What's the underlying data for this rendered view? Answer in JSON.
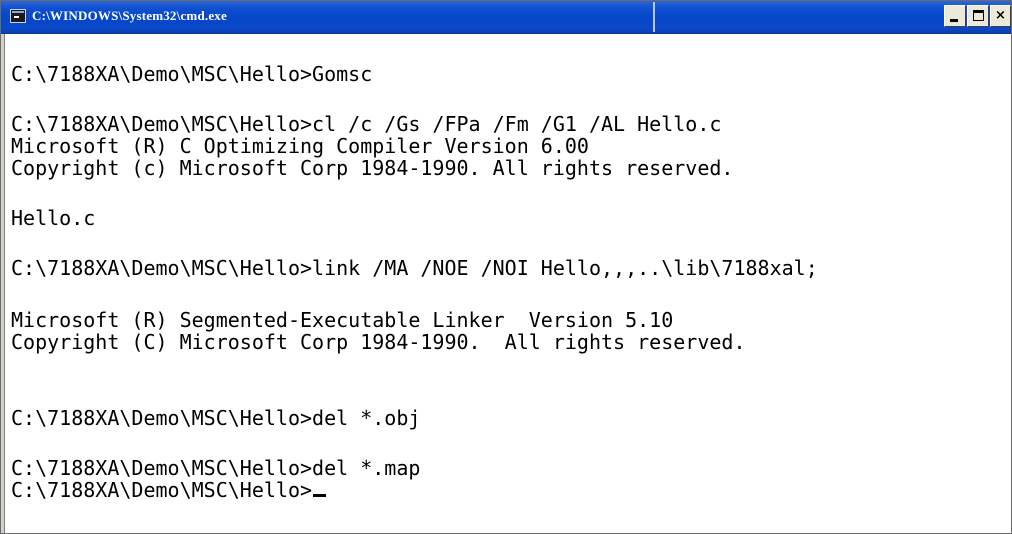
{
  "window": {
    "title": "C:\\WINDOWS\\System32\\cmd.exe",
    "buttons": {
      "minimize": "minimize",
      "maximize": "maximize",
      "close": "×"
    },
    "colors": {
      "titlebar": "#0a49c9",
      "console_background": "#ffffff",
      "console_text": "#000000"
    }
  },
  "console": {
    "lines": [
      "C:\\7188XA\\Demo\\MSC\\Hello>Gomsc",
      "C:\\7188XA\\Demo\\MSC\\Hello>cl /c /Gs /FPa /Fm /G1 /AL Hello.c",
      "Microsoft (R) C Optimizing Compiler Version 6.00",
      "Copyright (c) Microsoft Corp 1984-1990. All rights reserved.",
      "Hello.c",
      "C:\\7188XA\\Demo\\MSC\\Hello>link /MA /NOE /NOI Hello,,,..\\lib\\7188xal;",
      "Microsoft (R) Segmented-Executable Linker  Version 5.10",
      "Copyright (C) Microsoft Corp 1984-1990.  All rights reserved.",
      "C:\\7188XA\\Demo\\MSC\\Hello>del *.obj",
      "C:\\7188XA\\Demo\\MSC\\Hello>del *.map",
      "C:\\7188XA\\Demo\\MSC\\Hello>"
    ]
  }
}
